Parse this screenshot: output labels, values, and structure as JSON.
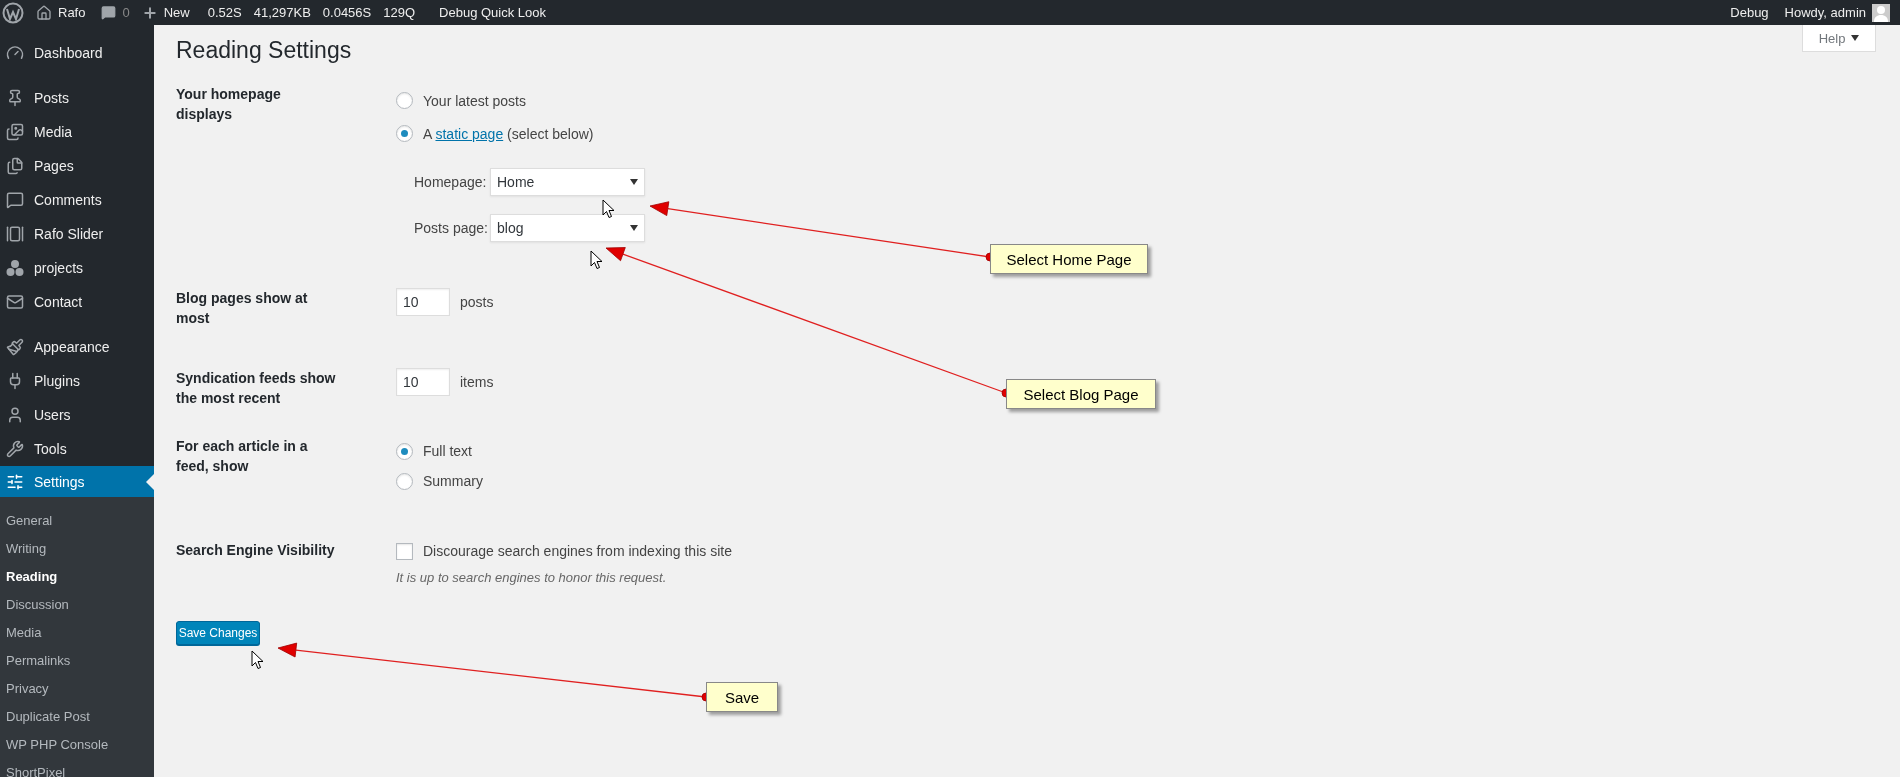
{
  "admin_bar": {
    "site_name": "Rafo",
    "comments_count": "0",
    "new_label": "New",
    "debug_stats": [
      "0.52S",
      "41,297KB",
      "0.0456S",
      "129Q"
    ],
    "quick_look": "Debug Quick Look",
    "debug": "Debug",
    "greeting": "Howdy, admin"
  },
  "help": {
    "label": "Help"
  },
  "sidebar": {
    "groups": [
      [
        {
          "label": "Dashboard",
          "selected": false
        }
      ],
      [
        {
          "label": "Posts",
          "selected": false
        },
        {
          "label": "Media",
          "selected": false
        },
        {
          "label": "Pages",
          "selected": false
        },
        {
          "label": "Comments",
          "selected": false
        },
        {
          "label": "Rafo Slider",
          "selected": false
        },
        {
          "label": "projects",
          "selected": false
        },
        {
          "label": "Contact",
          "selected": false
        }
      ],
      [
        {
          "label": "Appearance",
          "selected": false
        },
        {
          "label": "Plugins",
          "selected": false
        },
        {
          "label": "Users",
          "selected": false
        },
        {
          "label": "Tools",
          "selected": false
        },
        {
          "label": "Settings",
          "selected": true
        }
      ]
    ],
    "submenu": [
      {
        "label": "General",
        "selected": false
      },
      {
        "label": "Writing",
        "selected": false
      },
      {
        "label": "Reading",
        "selected": true
      },
      {
        "label": "Discussion",
        "selected": false
      },
      {
        "label": "Media",
        "selected": false
      },
      {
        "label": "Permalinks",
        "selected": false
      },
      {
        "label": "Privacy",
        "selected": false
      },
      {
        "label": "Duplicate Post",
        "selected": false
      },
      {
        "label": "WP PHP Console",
        "selected": false
      },
      {
        "label": "ShortPixel",
        "selected": false
      }
    ]
  },
  "title": "Reading Settings",
  "rows": [
    {
      "kind": "radio_group",
      "label": "Your homepage displays",
      "options": [
        {
          "label": "Your latest posts",
          "selected": false
        },
        {
          "label": "A",
          "link": "static page",
          "suffix": "(select below)",
          "selected": true
        }
      ],
      "page_selects": [
        {
          "label": "Homepage:",
          "value": "Home"
        },
        {
          "label": "Posts page:",
          "value": "blog"
        }
      ]
    },
    {
      "kind": "number",
      "label": "Blog pages show at most",
      "value": "10",
      "unit": "posts"
    },
    {
      "kind": "number",
      "label": "Syndication feeds show the most recent",
      "value": "10",
      "unit": "items"
    },
    {
      "kind": "radio_group",
      "label": "For each article in a feed, show",
      "options": [
        {
          "label": "Full text",
          "selected": true
        },
        {
          "label": "Summary",
          "selected": false
        }
      ]
    },
    {
      "kind": "checkbox",
      "label": "Search Engine Visibility",
      "option": "Discourage search engines from indexing this site",
      "checked": false,
      "hint": "It is up to search engines to honor this request."
    }
  ],
  "save_button": "Save Changes",
  "annotations": [
    {
      "text": "Select Home Page"
    },
    {
      "text": "Select Blog Page"
    },
    {
      "text": "Save"
    }
  ]
}
